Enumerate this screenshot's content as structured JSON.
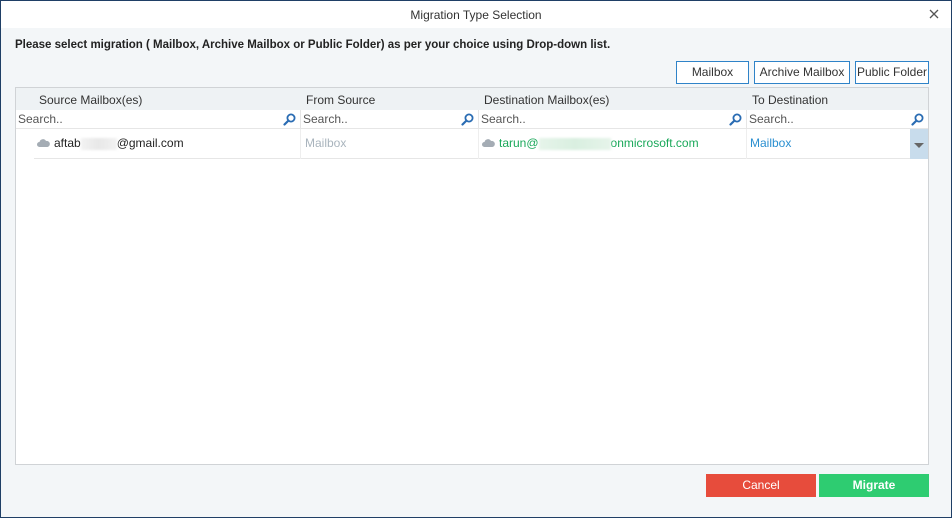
{
  "window": {
    "title": "Migration Type Selection",
    "close_icon": "close-icon"
  },
  "instruction": "Please select migration ( Mailbox, Archive Mailbox or Public Folder) as per your choice using Drop-down list.",
  "type_buttons": [
    {
      "label": "Mailbox"
    },
    {
      "label": "Archive Mailbox"
    },
    {
      "label": "Public Folder"
    }
  ],
  "grid": {
    "columns": [
      {
        "header": "Source Mailbox(es)",
        "search_placeholder": "Search.."
      },
      {
        "header": "From Source",
        "search_placeholder": "Search.."
      },
      {
        "header": "Destination Mailbox(es)",
        "search_placeholder": "Search.."
      },
      {
        "header": "To Destination",
        "search_placeholder": "Search.."
      }
    ],
    "rows": [
      {
        "source_prefix": "aftab",
        "source_suffix": "@gmail.com",
        "from_source": "Mailbox",
        "destination_prefix": "tarun@",
        "destination_suffix": "onmicrosoft.com",
        "to_destination": "Mailbox"
      }
    ]
  },
  "footer": {
    "cancel_label": "Cancel",
    "migrate_label": "Migrate"
  },
  "colors": {
    "accent_border": "#2f83c8",
    "cancel": "#e74c3c",
    "migrate": "#2ecc71",
    "destination_text": "#1aa85a",
    "to_destination_text": "#2a8fd0",
    "muted_text": "#a9b4bd"
  }
}
